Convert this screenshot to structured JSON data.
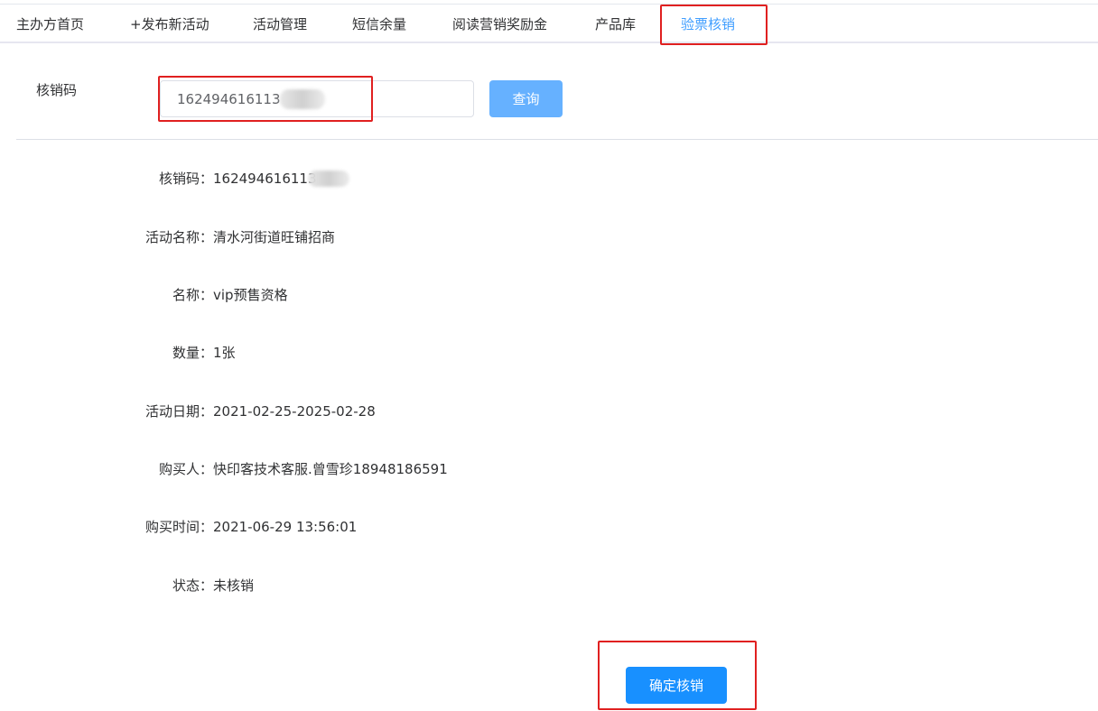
{
  "nav": {
    "tabs": [
      {
        "label": "主办方首页"
      },
      {
        "label": "+发布新活动"
      },
      {
        "label": "活动管理"
      },
      {
        "label": "短信余量"
      },
      {
        "label": "阅读营销奖励金"
      },
      {
        "label": "产品库"
      },
      {
        "label": "验票核销"
      }
    ],
    "active_tab": "验票核销"
  },
  "search": {
    "label": "核销码",
    "value": "162494616113",
    "button_label": "查询"
  },
  "details": {
    "code": {
      "label": "核销码：",
      "value": "162494616113"
    },
    "activity_name": {
      "label": "活动名称：",
      "value": "清水河街道旺铺招商"
    },
    "name": {
      "label": "名称：",
      "value": "vip预售资格"
    },
    "quantity": {
      "label": "数量：",
      "value": "1张"
    },
    "activity_date": {
      "label": "活动日期：",
      "value": "2021-02-25-2025-02-28"
    },
    "buyer": {
      "label": "购买人：",
      "value": "快印客技术客服.曾雪珍18948186591"
    },
    "purchase_time": {
      "label": "购买时间：",
      "value": "2021-06-29 13:56:01"
    },
    "status": {
      "label": "状态：",
      "value": "未核销"
    }
  },
  "confirm": {
    "button_label": "确定核销"
  },
  "colors": {
    "primary": "#1890ff",
    "query_button": "#66b1ff",
    "active_tab": "#409eff",
    "highlight_box": "#e02020"
  }
}
